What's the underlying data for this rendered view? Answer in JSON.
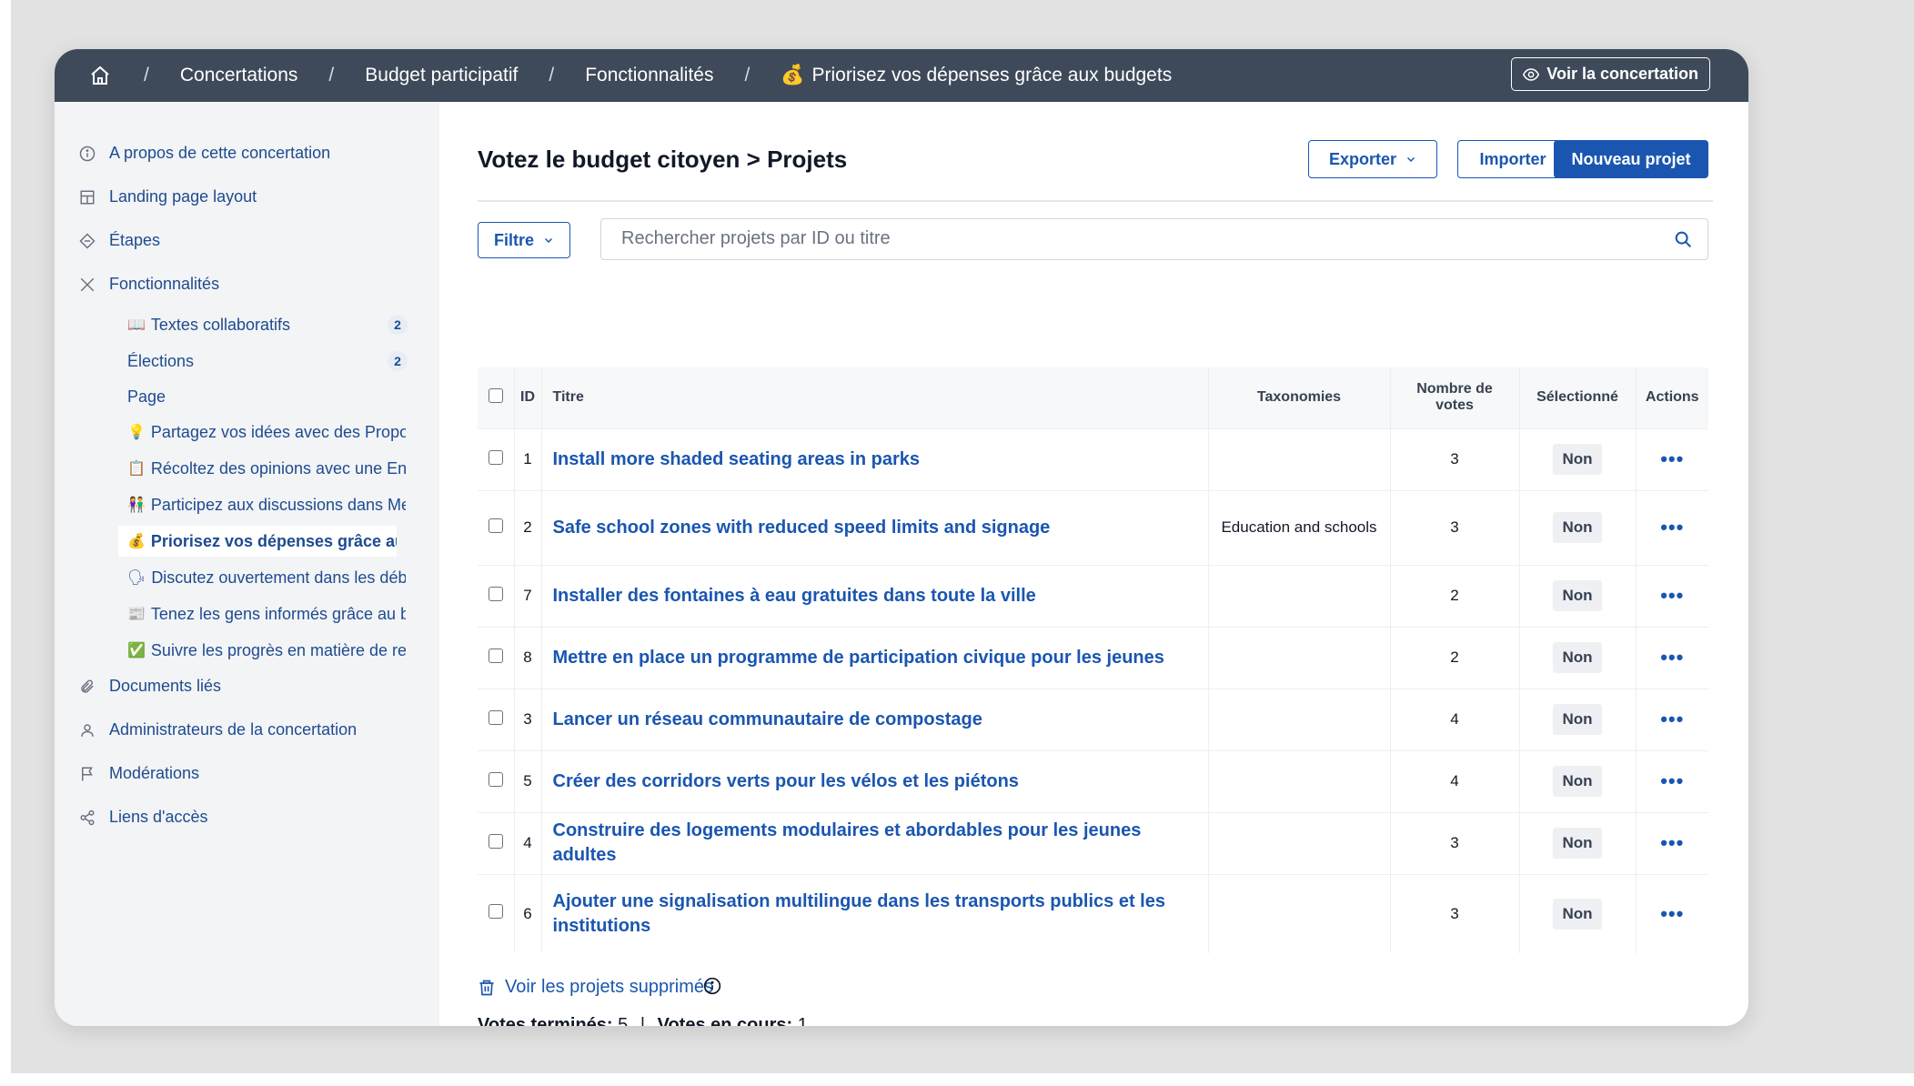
{
  "breadcrumb": {
    "items": [
      "Concertations",
      "Budget participatif",
      "Fonctionnalités",
      "Priorisez vos dépenses grâce aux budgets"
    ],
    "last_emoji": "💰",
    "separator": "/"
  },
  "topbar": {
    "view_button": "Voir la concertation"
  },
  "sidebar": {
    "items": [
      {
        "label": "A propos de cette concertation",
        "icon": "info-icon"
      },
      {
        "label": "Landing page layout",
        "icon": "layout-icon"
      },
      {
        "label": "Étapes",
        "icon": "steps-icon"
      },
      {
        "label": "Fonctionnalités",
        "icon": "tools-icon"
      }
    ],
    "subitems": [
      {
        "emoji": "📖",
        "label": "Textes collaboratifs",
        "badge": "2"
      },
      {
        "emoji": "",
        "label": "Élections",
        "badge": "2"
      },
      {
        "emoji": "",
        "label": "Page"
      },
      {
        "emoji": "💡",
        "label": "Partagez vos idées avec des Propositic"
      },
      {
        "emoji": "📋",
        "label": "Récoltez des opinions avec une Enquê"
      },
      {
        "emoji": "👫",
        "label": "Participez aux discussions dans Meetir"
      },
      {
        "emoji": "💰",
        "label": "Priorisez vos dépenses grâce aux bud"
      },
      {
        "emoji": "🗣",
        "label": "Discutez ouvertement dans les débats"
      },
      {
        "emoji": "📰",
        "label": "Tenez les gens informés grâce au blog"
      },
      {
        "emoji": "✅",
        "label": "Suivre les progrès en matière de respo"
      }
    ],
    "bottom_items": [
      {
        "label": "Documents liés",
        "icon": "paperclip-icon"
      },
      {
        "label": "Administrateurs de la concertation",
        "icon": "user-icon"
      },
      {
        "label": "Modérations",
        "icon": "flag-icon"
      },
      {
        "label": "Liens d'accès",
        "icon": "share-icon"
      }
    ]
  },
  "main": {
    "title": "Votez le budget citoyen > Projets",
    "export_label": "Exporter",
    "import_label": "Importer",
    "new_label": "Nouveau projet",
    "filter_label": "Filtre",
    "search_placeholder": "Rechercher projets par ID ou titre"
  },
  "table": {
    "headers": {
      "id": "ID",
      "title": "Titre",
      "tax": "Taxonomies",
      "votes_line1": "Nombre de",
      "votes_line2": "votes",
      "selected": "Sélectionné",
      "actions": "Actions"
    },
    "rows": [
      {
        "id": "1",
        "title": "Install more shaded seating areas in parks",
        "tax": "",
        "votes": "3",
        "selected": "Non"
      },
      {
        "id": "2",
        "title": "Safe school zones with reduced speed limits and signage",
        "tax": "Education and schools",
        "votes": "3",
        "selected": "Non"
      },
      {
        "id": "7",
        "title": "Installer des fontaines à eau gratuites dans toute la ville",
        "tax": "",
        "votes": "2",
        "selected": "Non"
      },
      {
        "id": "8",
        "title": "Mettre en place un programme de participation civique pour les jeunes",
        "tax": "",
        "votes": "2",
        "selected": "Non"
      },
      {
        "id": "3",
        "title": "Lancer un réseau communautaire de compostage",
        "tax": "",
        "votes": "4",
        "selected": "Non"
      },
      {
        "id": "5",
        "title": "Créer des corridors verts pour les vélos et les piétons",
        "tax": "",
        "votes": "4",
        "selected": "Non"
      },
      {
        "id": "4",
        "title": "Construire des logements modulaires et abordables pour les jeunes adultes",
        "tax": "",
        "votes": "3",
        "selected": "Non"
      },
      {
        "id": "6",
        "title": "Ajouter une signalisation multilingue dans les transports publics et les institutions",
        "tax": "",
        "votes": "3",
        "selected": "Non"
      }
    ]
  },
  "footer": {
    "deleted_link": "Voir les projets supprimés",
    "votes_done_label": "Votes terminés:",
    "votes_done_value": "5",
    "separator": "|",
    "votes_open_label": "Votes en cours:",
    "votes_open_value": "1"
  },
  "colors": {
    "topbar": "#3e4a5a",
    "accent": "#1a56b0",
    "sidebar_bg": "#f3f4f6",
    "link": "#1e4b8f"
  }
}
